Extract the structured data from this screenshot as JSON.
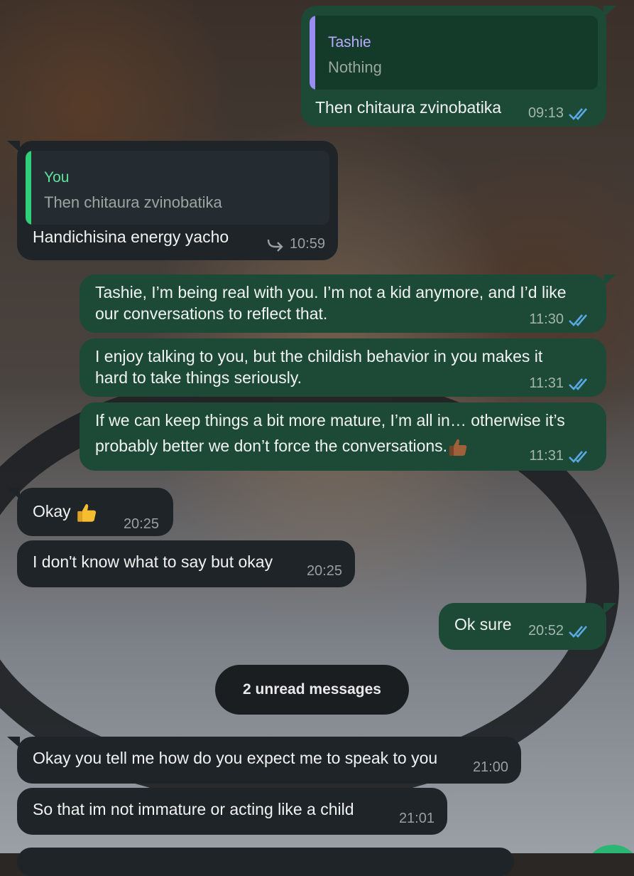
{
  "colors": {
    "outgoing_bubble": "#1c4a36",
    "incoming_bubble": "#1e2428",
    "read_ticks": "#5aa9e6",
    "quote_bar_contact": "#9b8cf2",
    "quote_bar_you": "#2fd07a"
  },
  "messages": [
    {
      "direction": "outgoing",
      "quote_author": "Tashie",
      "quote_text": "Nothing",
      "text": "Then chitaura zvinobatika",
      "time": "09:13",
      "status_icon": "double-check-icon"
    },
    {
      "direction": "incoming",
      "quote_author": "You",
      "quote_text": "Then chitaura zvinobatika",
      "text": "Handichisina energy yacho",
      "time": "10:59",
      "forward_icon": "forward-arrow-icon"
    },
    {
      "direction": "outgoing",
      "lines": [
        "Tashie, I’m being real with you. I’m not a kid anymore, and I’d like",
        "our conversations to reflect that."
      ],
      "time": "11:30",
      "status_icon": "double-check-icon"
    },
    {
      "direction": "outgoing",
      "lines": [
        "I enjoy talking to you, but the childish behavior in you  makes it",
        "hard to take things seriously."
      ],
      "time": "11:31",
      "status_icon": "double-check-icon"
    },
    {
      "direction": "outgoing",
      "lines": [
        "If we can keep things a bit more mature, I’m all in… otherwise it’s",
        "probably better we don’t force the conversations."
      ],
      "emoji_icon": "thumbs-up-dark-icon",
      "time": "11:31",
      "status_icon": "double-check-icon"
    },
    {
      "direction": "incoming",
      "text": "Okay",
      "emoji_icon": "thumbs-up-icon",
      "time": "20:25"
    },
    {
      "direction": "incoming",
      "text": "I don't know what to say but okay",
      "time": "20:25"
    },
    {
      "direction": "outgoing",
      "text": "Ok sure",
      "time": "20:52",
      "status_icon": "double-check-icon"
    },
    {
      "direction": "incoming",
      "text": "Okay you tell me how do you expect me to speak to you",
      "time": "21:00"
    },
    {
      "direction": "incoming",
      "text": "So that im not immature or acting like a child",
      "time": "21:01"
    }
  ],
  "unread_divider": "2 unread messages"
}
